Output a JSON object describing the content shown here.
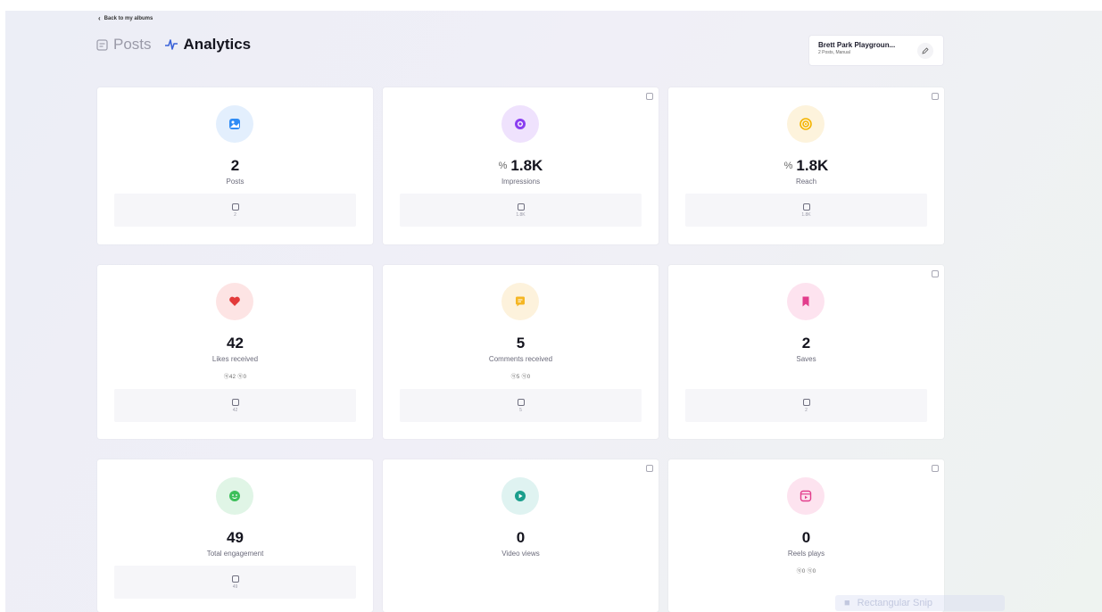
{
  "nav": {
    "back_label": "Back to my albums"
  },
  "tabs": [
    {
      "label": "Posts",
      "icon": "posts-icon"
    },
    {
      "label": "Analytics",
      "icon": "analytics-icon",
      "active": true
    }
  ],
  "album": {
    "title": "Brett Park Playgroun...",
    "subtitle": "2 Posts, Manual"
  },
  "colors": {
    "posts": "#2f8cf5",
    "impressions": "#8a3ef0",
    "reach": "#f4b400",
    "likes": "#e33b3b",
    "comments": "#f5b623",
    "saves": "#e23d8c",
    "engagement": "#3dbf5a",
    "video": "#1a9e8c",
    "reels": "#e23d8c"
  },
  "metrics": [
    {
      "icon": "image-icon",
      "value": "2",
      "label": "Posts",
      "footer": "2",
      "link": false,
      "info": false
    },
    {
      "icon": "eye-icon",
      "value": "1.8K",
      "label": "Impressions",
      "footer": "1.8K",
      "link": true,
      "info": true
    },
    {
      "icon": "target-icon",
      "value": "1.8K",
      "label": "Reach",
      "footer": "1.8K",
      "link": true,
      "info": true
    },
    {
      "icon": "heart-icon",
      "value": "42",
      "label": "Likes received",
      "sub": "ⓠ42 ⓠ0",
      "footer": "42",
      "link": false,
      "info": false
    },
    {
      "icon": "comment-icon",
      "value": "5",
      "label": "Comments received",
      "sub": "ⓠ5 ⓠ0",
      "footer": "5",
      "link": false,
      "info": false
    },
    {
      "icon": "bookmark-icon",
      "value": "2",
      "label": "Saves",
      "footer": "2",
      "link": false,
      "info": true
    },
    {
      "icon": "engagement-icon",
      "value": "49",
      "label": "Total engagement",
      "footer": "49",
      "link": false,
      "info": false
    },
    {
      "icon": "play-icon",
      "value": "0",
      "label": "Video views",
      "link": false,
      "info": true
    },
    {
      "icon": "reels-icon",
      "value": "0",
      "label": "Reels plays",
      "sub": "ⓠ0 ⓠ0",
      "link": false,
      "info": true
    }
  ],
  "watermark": "Rectangular Snip"
}
